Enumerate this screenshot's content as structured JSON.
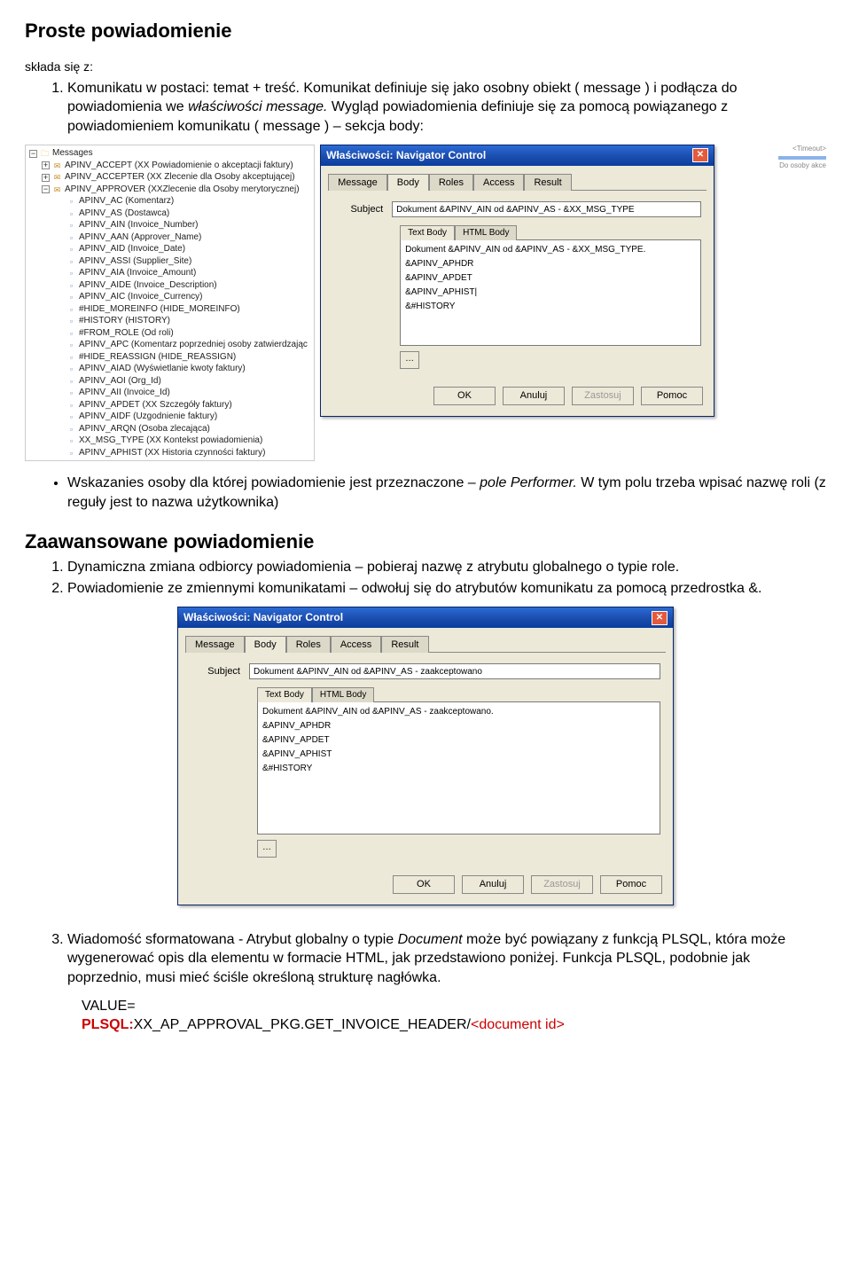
{
  "headings": {
    "h1": "Proste powiadomienie",
    "h2": "Zaawansowane powiadomienie"
  },
  "intro": "składa się z:",
  "list1": [
    {
      "pre": "Komunikatu w postaci: temat + treść. Komunikat definiuje się jako osobny obiekt ( message ) i podłącza do powiadomienia we ",
      "it1": "właściwości message.",
      "post": " Wygląd powiadomienia definiuje się za pomocą powiązanego z powiadomieniem komunikatu ( message ) – sekcja body:"
    }
  ],
  "bullet1": {
    "pre": "Wskazanies osoby dla której powiadomienie jest przeznaczone – ",
    "it": "pole Performer.",
    "post": " W tym polu trzeba wpisać nazwę roli (z reguły jest to nazwa użytkownika)"
  },
  "list2": [
    "Dynamiczna zmiana odbiorcy powiadomienia – pobieraj nazwę z atrybutu globalnego o typie role.",
    "Powiadomienie ze zmiennymi komunikatami – odwołuj się do atrybutów komunikatu za pomocą przedrostka &."
  ],
  "list3": {
    "pre": "Wiadomość sformatowana -  Atrybut globalny o typie ",
    "it": "Document",
    "post": " może być powiązany z funkcją PLSQL, która może wygenerować opis dla elementu w formacie HTML, jak przedstawiono poniżej. Funkcja PLSQL, podobnie jak poprzednio, musi mieć ściśle określoną strukturę nagłówka."
  },
  "valblock": {
    "l1": "VALUE=",
    "l2a": "PLSQL:",
    "l2b": "XX_AP_APPROVAL_PKG.GET_INVOICE_HEADER/",
    "l2c": "<document id>"
  },
  "tree": {
    "root": "Messages",
    "l1": [
      "APINV_ACCEPT (XX Powiadomienie o akceptacji faktury)",
      "APINV_ACCEPTER (XX Zlecenie dla Osoby akceptującej)",
      "APINV_APPROVER (XXZlecenie dla Osoby merytorycznej)"
    ],
    "l2": [
      "APINV_AC (Komentarz)",
      "APINV_AS (Dostawca)",
      "APINV_AIN (Invoice_Number)",
      "APINV_AAN (Approver_Name)",
      "APINV_AID (Invoice_Date)",
      "APINV_ASSI (Supplier_Site)",
      "APINV_AIA (Invoice_Amount)",
      "APINV_AIDE (Invoice_Description)",
      "APINV_AIC (Invoice_Currency)",
      "#HIDE_MOREINFO (HIDE_MOREINFO)",
      "#HISTORY (HISTORY)",
      "#FROM_ROLE (Od roli)",
      "APINV_APC (Komentarz poprzedniej osoby zatwierdzając",
      "#HIDE_REASSIGN (HIDE_REASSIGN)",
      "APINV_AIAD (Wyświetlanie kwoty faktury)",
      "APINV_AOI (Org_Id)",
      "APINV_AII (Invoice_Id)",
      "APINV_APDET (XX Szczegóły faktury)",
      "APINV_AIDF (Uzgodnienie faktury)",
      "APINV_ARQN (Osoba zlecająca)",
      "XX_MSG_TYPE (XX Kontekst powiadomienia)",
      "APINV_APHIST (XX Historia czynności faktury)"
    ]
  },
  "bgnoise": {
    "timeout": "<Timeout>",
    "sub": "Do osoby akce"
  },
  "dialog": {
    "title": "Właściwości: Navigator Control",
    "tabs": [
      "Message",
      "Body",
      "Roles",
      "Access",
      "Result"
    ],
    "active_tab": "Body",
    "subject_label": "Subject",
    "subtabs": [
      "Text Body",
      "HTML Body"
    ],
    "active_subtab": "Text Body",
    "buttons": {
      "ok": "OK",
      "cancel": "Anuluj",
      "apply": "Zastosuj",
      "help": "Pomoc"
    }
  },
  "dialog1": {
    "subject": "Dokument &APINV_AIN od &APINV_AS - &XX_MSG_TYPE",
    "lines": [
      "Dokument &APINV_AIN od &APINV_AS - &XX_MSG_TYPE.",
      "&APINV_APHDR",
      "&APINV_APDET",
      "&APINV_APHIST|",
      "&#HISTORY"
    ]
  },
  "dialog2": {
    "subject": "Dokument &APINV_AIN od &APINV_AS - zaakceptowano",
    "lines": [
      "Dokument &APINV_AIN od &APINV_AS - zaakceptowano.",
      "&APINV_APHDR",
      "&APINV_APDET",
      "&APINV_APHIST",
      "&#HISTORY"
    ]
  }
}
